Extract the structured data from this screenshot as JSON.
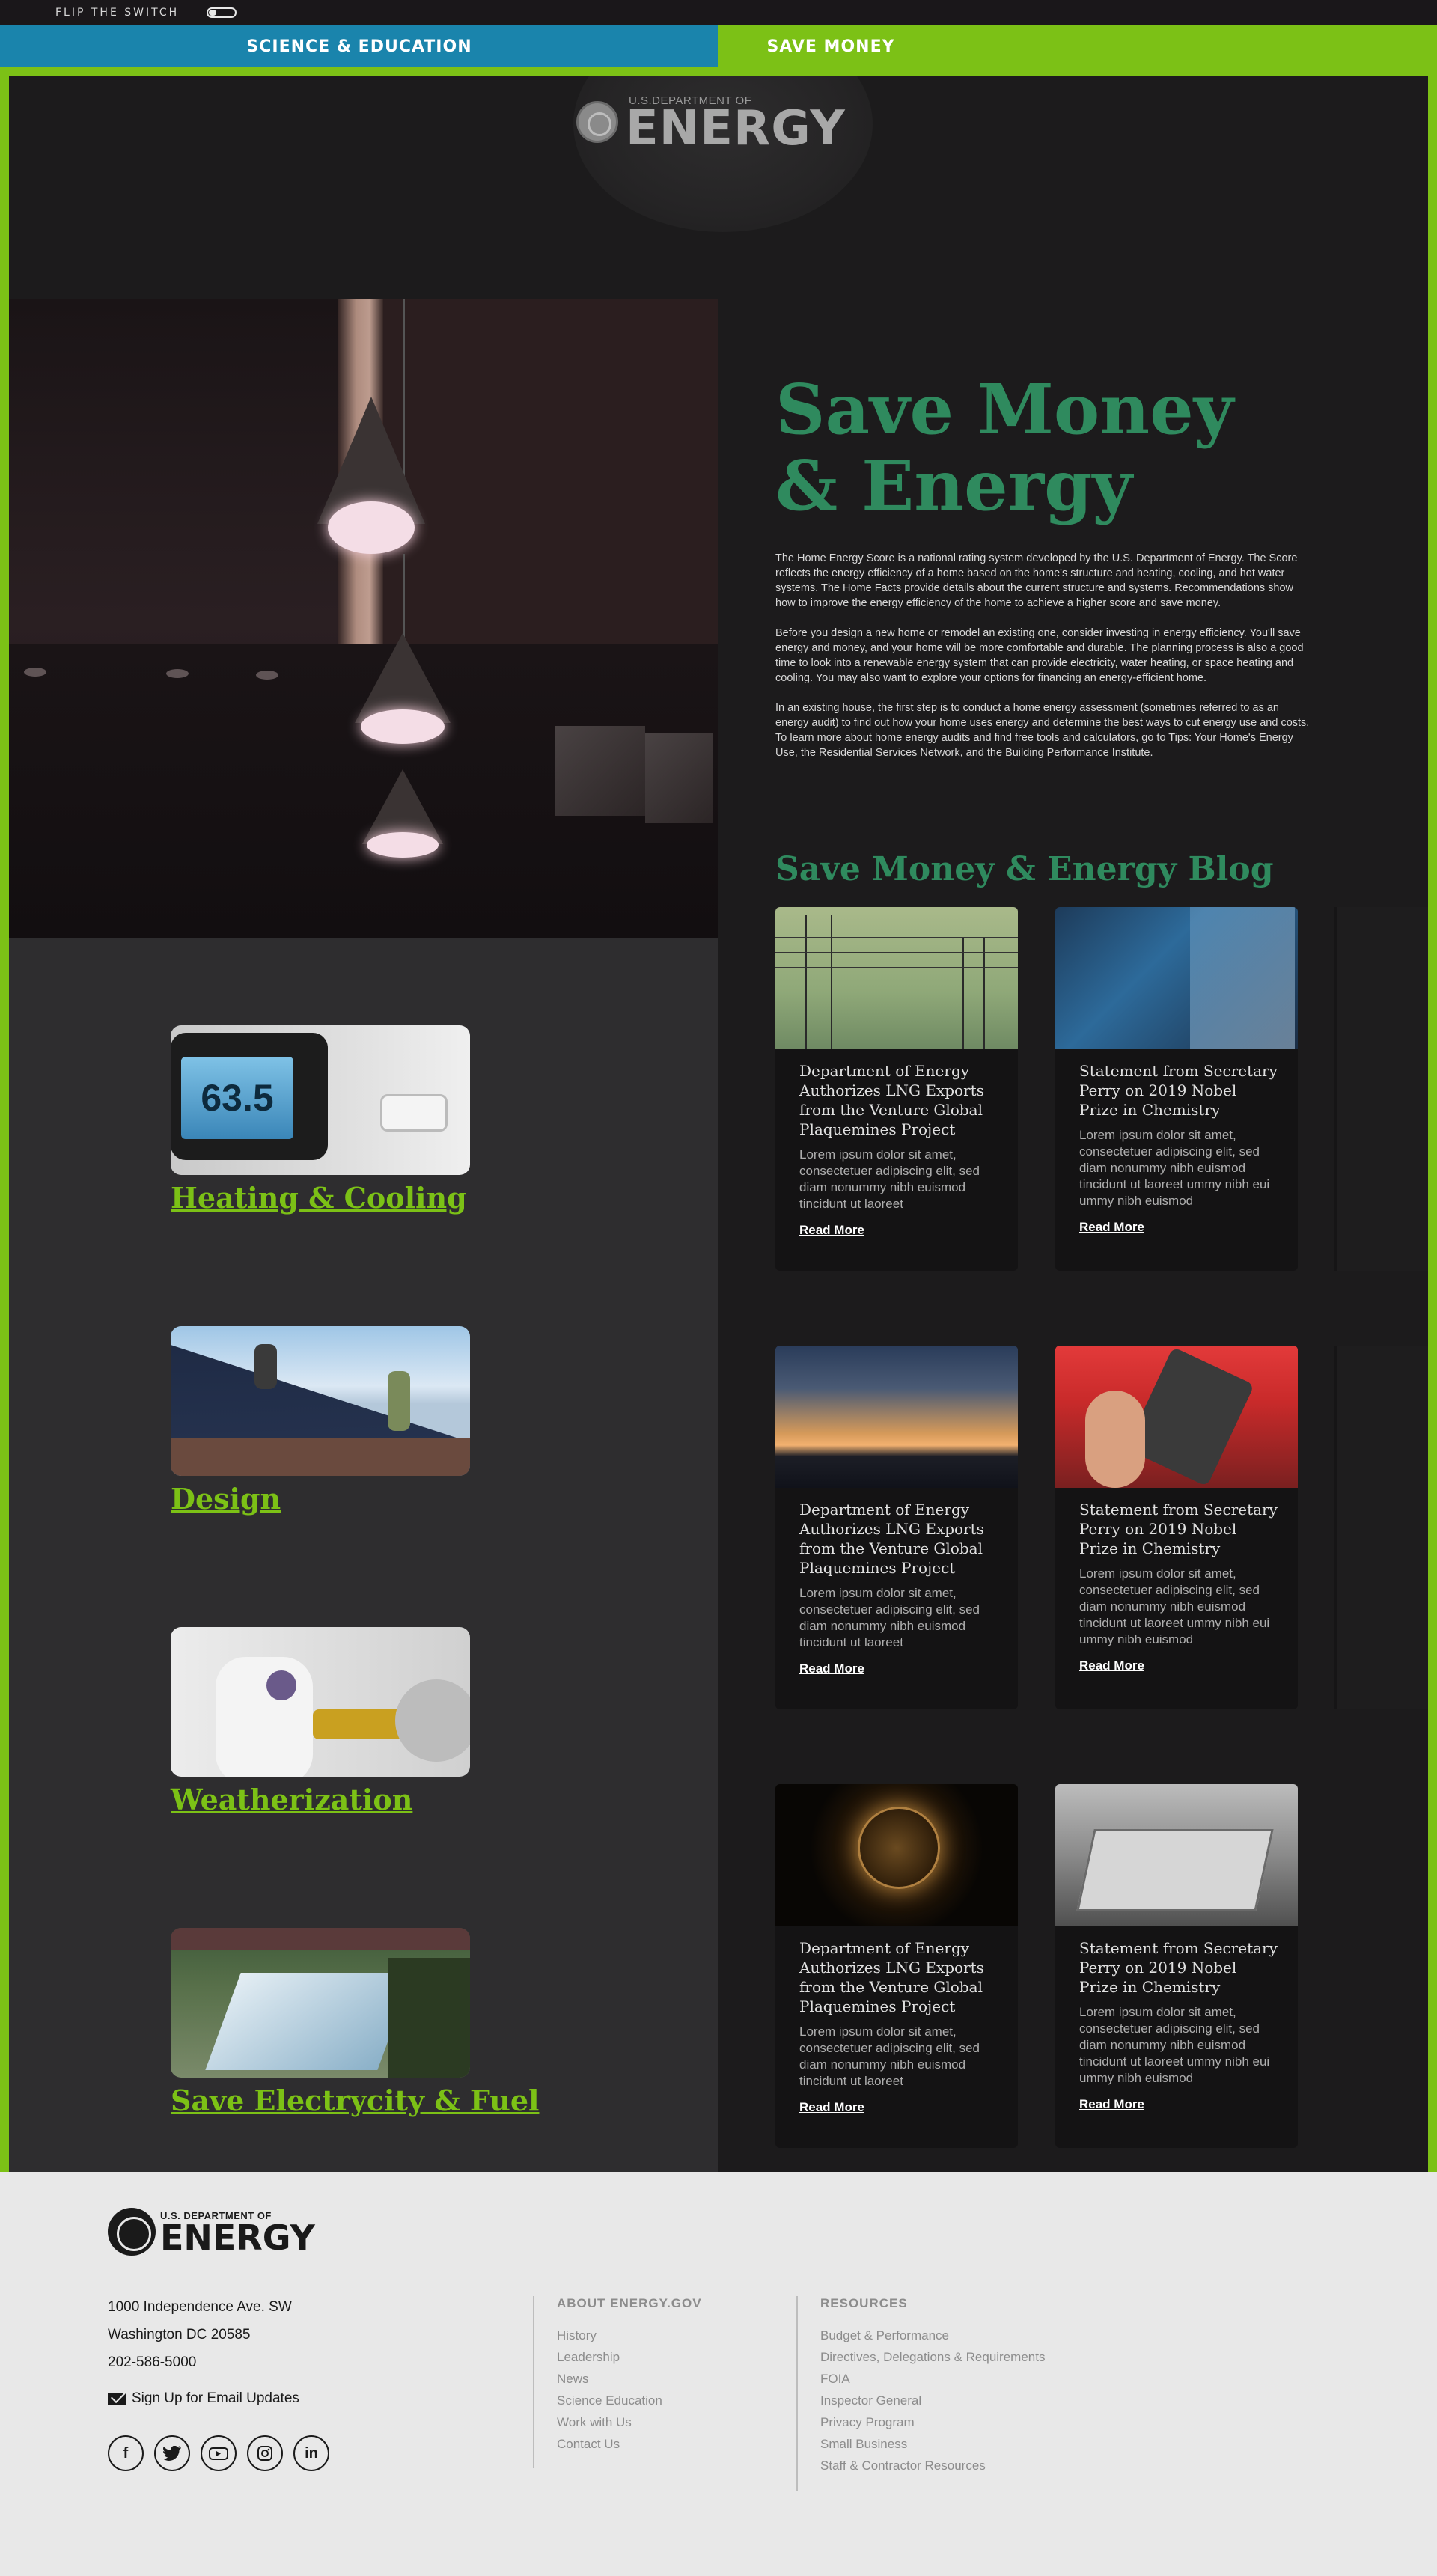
{
  "util": {
    "flip_label": "FLIP THE SWITCH"
  },
  "nav": {
    "tabs": [
      "SCIENCE & EDUCATION",
      "SAVE MONEY"
    ]
  },
  "logo": {
    "small": "U.S.DEPARTMENT OF",
    "big": "ENERGY"
  },
  "hero": {
    "headline_line1": "Save Money",
    "headline_line2": "& Energy",
    "paragraphs": [
      "The Home Energy Score is a national rating system developed by the U.S. Department of Energy. The Score reflects the energy efficiency of a home based on the home's structure and heating, cooling, and hot water systems. The Home Facts provide details about the current structure and systems. Recommendations show how to improve the energy efficiency of the home to achieve a higher score and save money.",
      "Before you design a new home or remodel an existing one, consider investing in energy efficiency. You'll save energy and money, and your home will be more comfortable and durable. The planning process is also a good time to look into a renewable energy system that can provide electricity, water heating, or space heating and cooling. You may also want to explore your options for financing an energy-efficient home.",
      "In an existing house, the first step is to conduct a home energy assessment (sometimes referred to as an energy audit) to find out how your home uses energy and determine the best ways to cut energy use and costs. To learn more about home energy audits and find free tools and calculators, go to Tips: Your Home's Energy Use, the Residential Services Network, and the Building Performance Institute."
    ]
  },
  "categories": [
    {
      "label": "Heating & Cooling",
      "thumb_text": "63.5"
    },
    {
      "label": "Design"
    },
    {
      "label": "Weatherization"
    },
    {
      "label": "Save Electrycity & Fuel"
    }
  ],
  "blog": {
    "title": "Save Money & Energy Blog",
    "cards": [
      {
        "title": "Department of Energy Authorizes LNG  Exports from the  Venture Global Plaquemines Project",
        "excerpt": "Lorem ipsum dolor sit amet, consectetuer adipiscing elit, sed diam nonummy nibh euismod tincidunt ut laoreet",
        "link": "Read More"
      },
      {
        "title": "Statement from Secretary Perry on 2019 Nobel Prize in Chemistry",
        "excerpt": "Lorem ipsum dolor sit amet, consectetuer adipiscing elit, sed diam nonummy nibh euismod tincidunt ut laoreet ummy nibh eui ummy nibh euismod",
        "link": "Read More"
      },
      {
        "title": "Department of Energy Authorizes LNG  Exports from the  Venture Global Plaquemines Project",
        "excerpt": "Lorem ipsum dolor sit amet, consectetuer adipiscing elit, sed diam nonummy nibh euismod tincidunt ut laoreet",
        "link": "Read More"
      },
      {
        "title": "Statement from Secretary Perry on 2019 Nobel Prize in Chemistry",
        "excerpt": "Lorem ipsum dolor sit amet, consectetuer adipiscing elit, sed diam nonummy nibh euismod tincidunt ut laoreet ummy nibh eui ummy nibh euismod",
        "link": "Read More"
      },
      {
        "title": "Department of Energy Authorizes LNG  Exports from the  Venture Global Plaquemines Project",
        "excerpt": "Lorem ipsum dolor sit amet, consectetuer adipiscing elit, sed diam nonummy nibh euismod tincidunt ut laoreet",
        "link": "Read More"
      },
      {
        "title": "Statement from Secretary Perry on 2019 Nobel Prize in Chemistry",
        "excerpt": "Lorem ipsum dolor sit amet, consectetuer adipiscing elit, sed diam nonummy nibh euismod tincidunt ut laoreet ummy nibh eui ummy nibh euismod",
        "link": "Read More"
      }
    ]
  },
  "footer": {
    "logo_small": "U.S. DEPARTMENT OF",
    "logo_big": "ENERGY",
    "address": [
      "1000 Independence Ave. SW",
      "Washington DC 20585",
      "202-586-5000"
    ],
    "signup": "Sign Up for Email Updates",
    "social": [
      "facebook-icon",
      "twitter-icon",
      "youtube-icon",
      "instagram-icon",
      "linkedin-icon"
    ],
    "about": {
      "heading": "ABOUT ENERGY.GOV",
      "links": [
        "History",
        "Leadership",
        "News",
        "Science Education",
        "Work with Us",
        "Contact Us"
      ]
    },
    "resources": {
      "heading": "RESOURCES",
      "links": [
        "Budget & Performance",
        "Directives, Delegations & Requirements",
        "FOIA",
        "Inspector General",
        "Privacy Program",
        "Small Business",
        "Staff & Contractor Resources"
      ]
    }
  },
  "colors": {
    "green": "#7cc116",
    "blue": "#1a84ac",
    "teal_heading": "#2f8a5e",
    "dark": "#1c1b1c"
  }
}
